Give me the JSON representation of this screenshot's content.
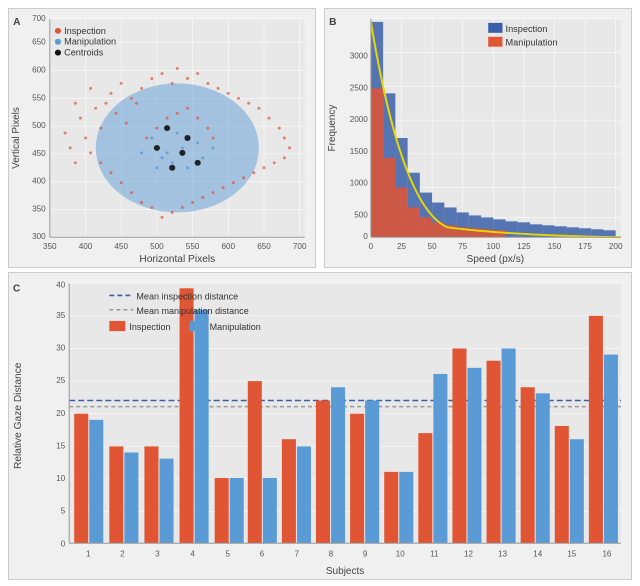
{
  "panels": {
    "a": {
      "label": "A",
      "x_axis": "Horizontal Pixels",
      "y_axis": "Vertical Pixels",
      "x_ticks": [
        "350",
        "400",
        "450",
        "500",
        "550",
        "600",
        "650",
        "700"
      ],
      "y_ticks": [
        "300",
        "350",
        "400",
        "450",
        "500",
        "550",
        "600",
        "650",
        "700"
      ],
      "legend": [
        {
          "label": "Inspection",
          "color": "#e05533"
        },
        {
          "label": "Manipulation",
          "color": "#5b9bd5"
        },
        {
          "label": "Centroids",
          "color": "#111111"
        }
      ]
    },
    "b": {
      "label": "B",
      "x_axis": "Speed (px/s)",
      "y_axis": "Frequency",
      "x_ticks": [
        "0",
        "25",
        "50",
        "75",
        "100",
        "125",
        "150",
        "175",
        "200"
      ],
      "y_ticks": [
        "0",
        "500",
        "1000",
        "1500",
        "2000",
        "2500",
        "3000"
      ],
      "legend": [
        {
          "label": "Inspection",
          "color": "#3a5fa8"
        },
        {
          "label": "Manipulation",
          "color": "#e05533"
        }
      ]
    },
    "c": {
      "label": "C",
      "x_axis": "Subjects",
      "y_axis": "Relative Gaze Distance",
      "x_ticks": [
        "1",
        "2",
        "3",
        "4",
        "5",
        "6",
        "7",
        "8",
        "9",
        "10",
        "11",
        "12",
        "13",
        "14",
        "15",
        "16"
      ],
      "y_ticks": [
        "0",
        "5",
        "10",
        "15",
        "20",
        "25",
        "30",
        "35",
        "40"
      ],
      "legend": [
        {
          "label": "Mean inspection distance",
          "color": "#3a5fa8",
          "style": "dashed"
        },
        {
          "label": "Mean manipulation distance",
          "color": "#888888",
          "style": "dashed"
        },
        {
          "label": "Inspection",
          "color": "#e05533"
        },
        {
          "label": "Manipulation",
          "color": "#5b9bd5"
        }
      ],
      "bars": {
        "inspection": [
          20,
          15,
          15,
          39,
          10,
          25,
          16,
          22,
          20,
          11,
          17,
          30,
          28,
          24,
          18,
          35
        ],
        "manipulation": [
          19,
          14,
          13,
          36,
          10,
          10,
          15,
          24,
          22,
          11,
          26,
          27,
          29,
          23,
          16,
          29
        ]
      },
      "mean_inspection": 22,
      "mean_manipulation": 21
    }
  }
}
